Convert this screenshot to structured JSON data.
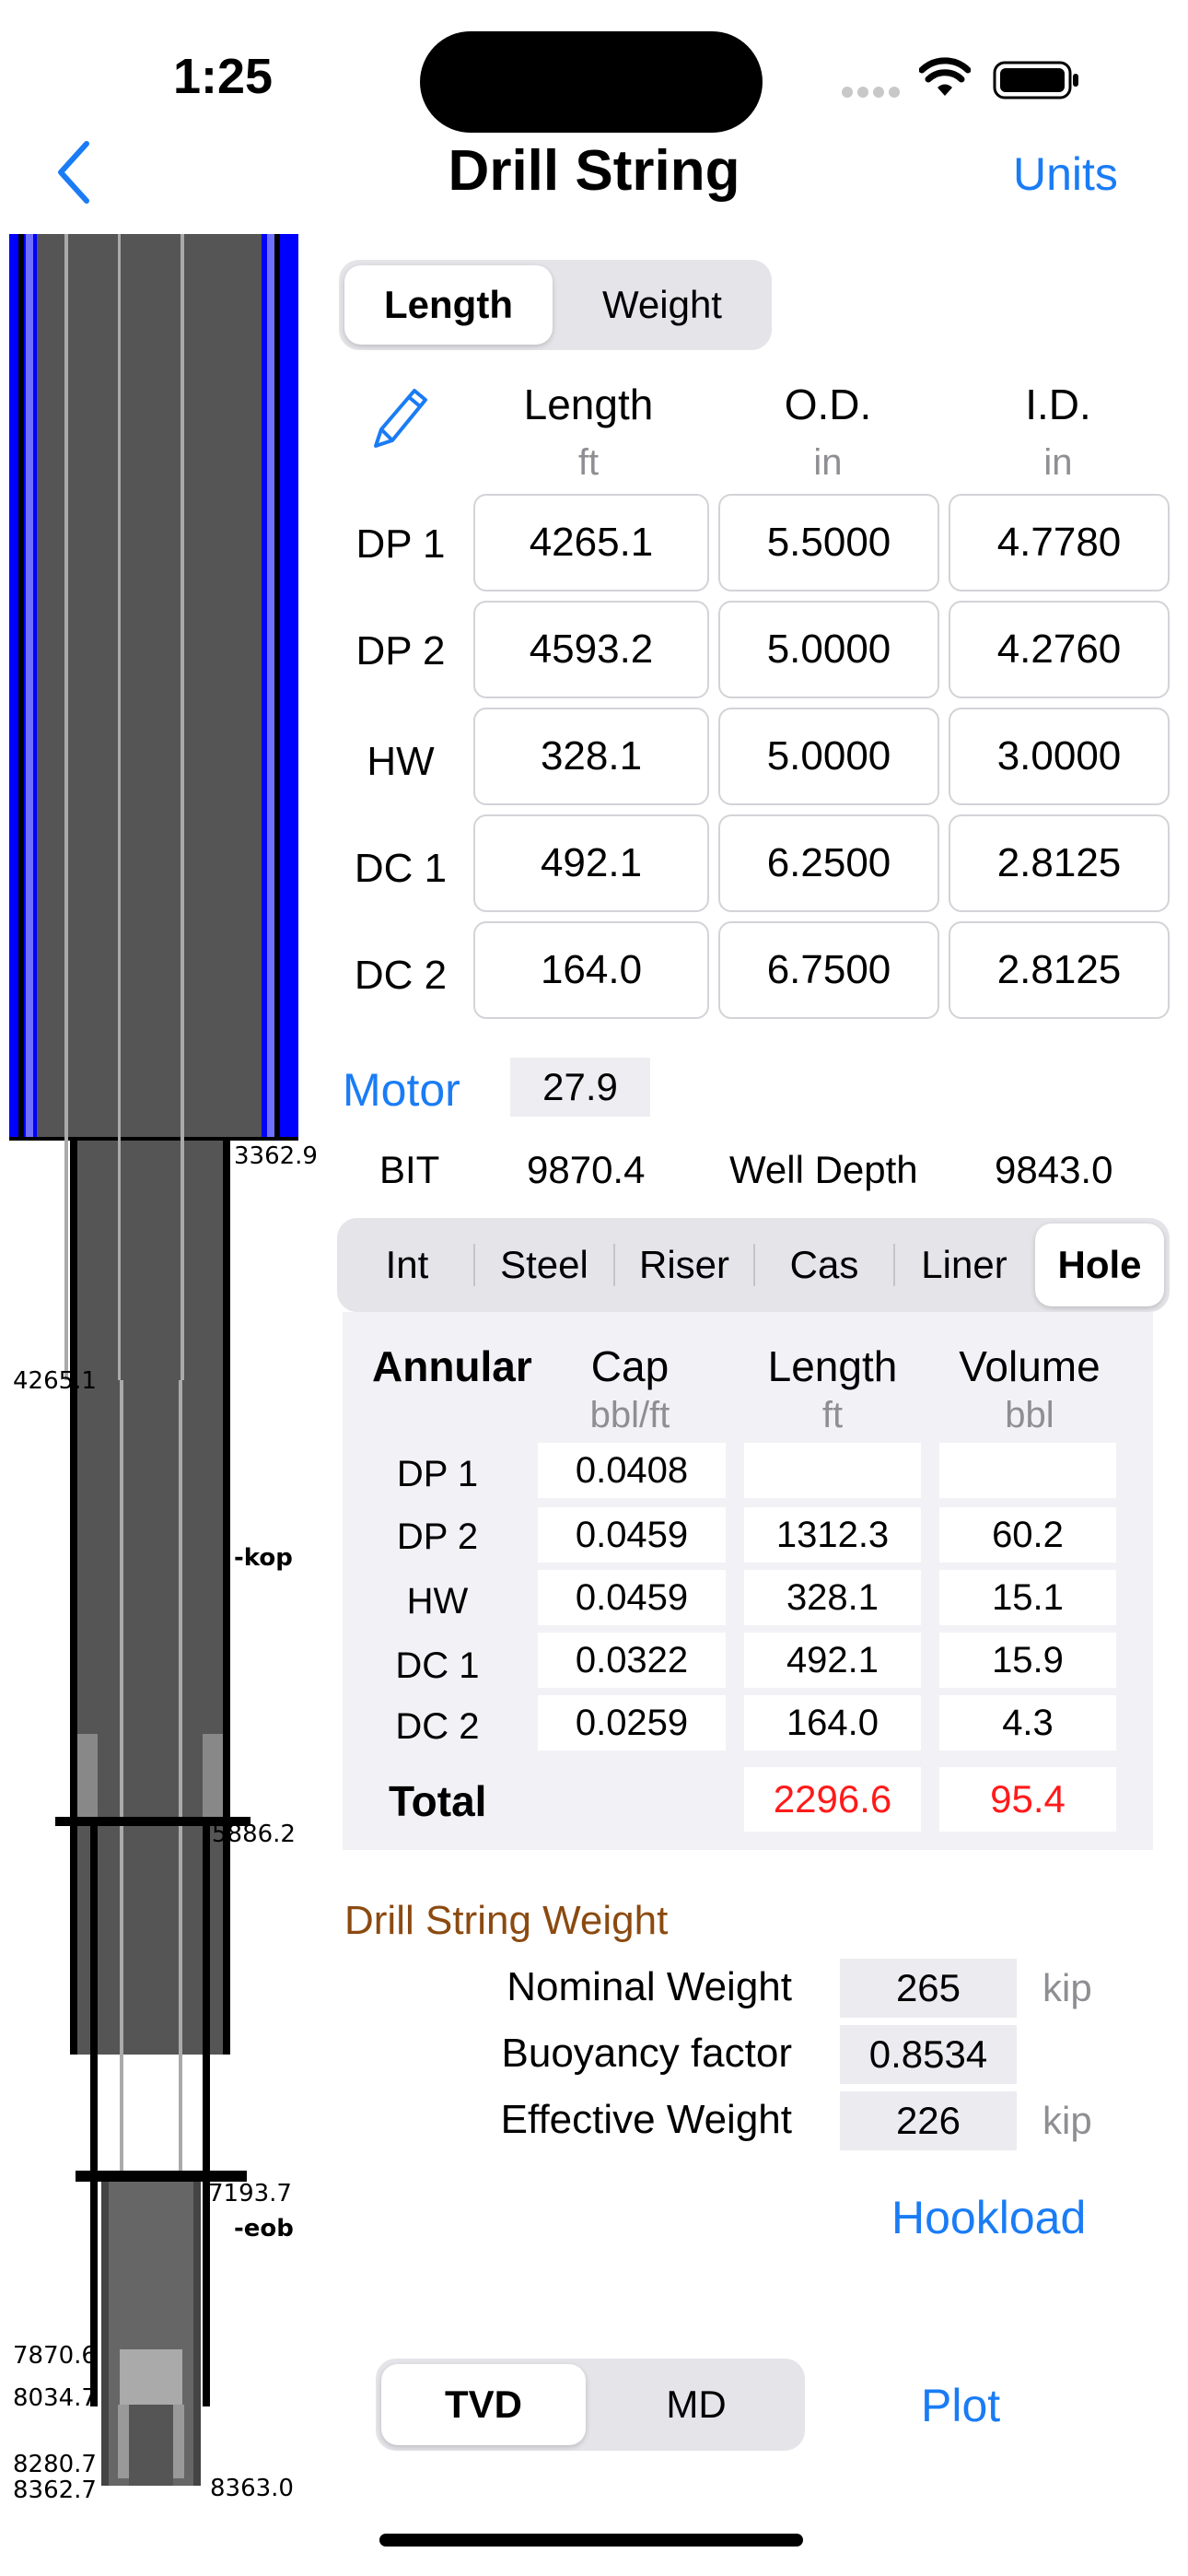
{
  "status": {
    "time": "1:25"
  },
  "nav": {
    "title": "Drill String",
    "units_label": "Units"
  },
  "mode_tabs": {
    "items": [
      "Length",
      "Weight"
    ],
    "selected": "Length"
  },
  "string_table": {
    "columns": [
      {
        "label": "Length",
        "unit": "ft"
      },
      {
        "label": "O.D.",
        "unit": "in"
      },
      {
        "label": "I.D.",
        "unit": "in"
      }
    ],
    "rows": [
      {
        "name": "DP 1",
        "values": [
          "4265.1",
          "5.5000",
          "4.7780"
        ]
      },
      {
        "name": "DP 2",
        "values": [
          "4593.2",
          "5.0000",
          "4.2760"
        ]
      },
      {
        "name": "HW",
        "values": [
          "328.1",
          "5.0000",
          "3.0000"
        ]
      },
      {
        "name": "DC 1",
        "values": [
          "492.1",
          "6.2500",
          "2.8125"
        ]
      },
      {
        "name": "DC 2",
        "values": [
          "164.0",
          "6.7500",
          "2.8125"
        ]
      }
    ]
  },
  "motor": {
    "label": "Motor",
    "value": "27.9"
  },
  "bit": {
    "label": "BIT",
    "value": "9870.4",
    "well_depth_label": "Well Depth",
    "well_depth_value": "9843.0"
  },
  "section_tabs": {
    "items": [
      "Int",
      "Steel",
      "Riser",
      "Cas",
      "Liner",
      "Hole"
    ],
    "selected": "Hole"
  },
  "annular": {
    "title": "Annular",
    "columns": [
      {
        "label": "Cap",
        "unit": "bbl/ft"
      },
      {
        "label": "Length",
        "unit": "ft"
      },
      {
        "label": "Volume",
        "unit": "bbl"
      }
    ],
    "rows": [
      {
        "name": "DP 1",
        "cap": "0.0408",
        "length": "",
        "volume": ""
      },
      {
        "name": "DP 2",
        "cap": "0.0459",
        "length": "1312.3",
        "volume": "60.2"
      },
      {
        "name": "HW",
        "cap": "0.0459",
        "length": "328.1",
        "volume": "15.1"
      },
      {
        "name": "DC 1",
        "cap": "0.0322",
        "length": "492.1",
        "volume": "15.9"
      },
      {
        "name": "DC 2",
        "cap": "0.0259",
        "length": "164.0",
        "volume": "4.3"
      }
    ],
    "total_label": "Total",
    "total_length": "2296.6",
    "total_volume": "95.4",
    "total_color": "#ff1a1a"
  },
  "weight": {
    "title": "Drill String Weight",
    "nominal_label": "Nominal Weight",
    "nominal_value": "265",
    "nominal_unit": "kip",
    "buoyancy_label": "Buoyancy factor",
    "buoyancy_value": "0.8534",
    "effective_label": "Effective Weight",
    "effective_value": "226",
    "effective_unit": "kip"
  },
  "hookload_label": "Hookload",
  "depth_tabs": {
    "items": [
      "TVD",
      "MD"
    ],
    "selected": "TVD"
  },
  "plot_label": "Plot",
  "schematic": {
    "labels": {
      "d1": "3362.9",
      "d2": "4265.1",
      "kop": "-kop",
      "d3": "5886.2",
      "d4": "7193.7",
      "eob": "-eob",
      "d5": "7870.6",
      "d6": "8034.7",
      "d7": "8280.7",
      "d8": "8362.7",
      "d9": "8363.0"
    }
  },
  "colors": {
    "accent": "#1a7cf5",
    "casing_blue": "#0000ff",
    "pipe_gray": "#555555",
    "weight_title": "#8b4a10"
  }
}
